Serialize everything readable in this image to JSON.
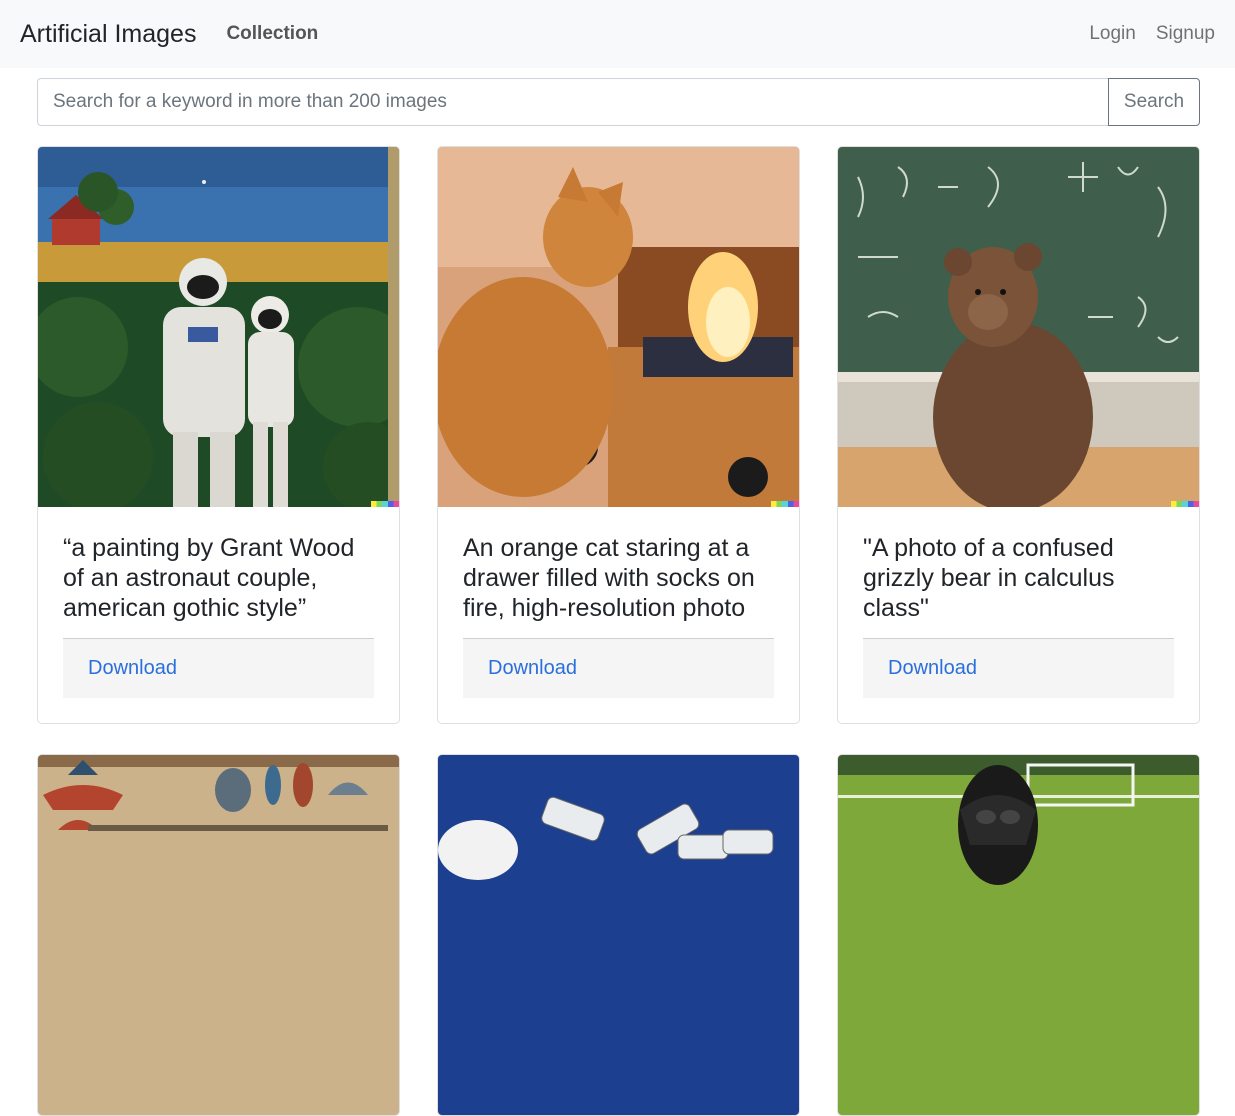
{
  "navbar": {
    "brand": "Artificial Images",
    "collection": "Collection",
    "login": "Login",
    "signup": "Signup"
  },
  "search": {
    "placeholder": "Search for a keyword in more than 200 images",
    "button": "Search"
  },
  "cards": [
    {
      "title": "“a painting by Grant Wood of an astronaut couple, american gothic style”",
      "download": "Download",
      "image": "astronaut-couple-painting"
    },
    {
      "title": "An orange cat staring at a drawer filled with socks on fire, high-resolution photo",
      "download": "Download",
      "image": "orange-cat-drawer-fire"
    },
    {
      "title": "\"A photo of a confused grizzly bear in calculus class\"",
      "download": "Download",
      "image": "grizzly-bear-chalkboard"
    },
    {
      "image": "egyptian-style-painting"
    },
    {
      "image": "security-cameras-sky"
    },
    {
      "image": "darth-vader-soccer-field"
    }
  ]
}
